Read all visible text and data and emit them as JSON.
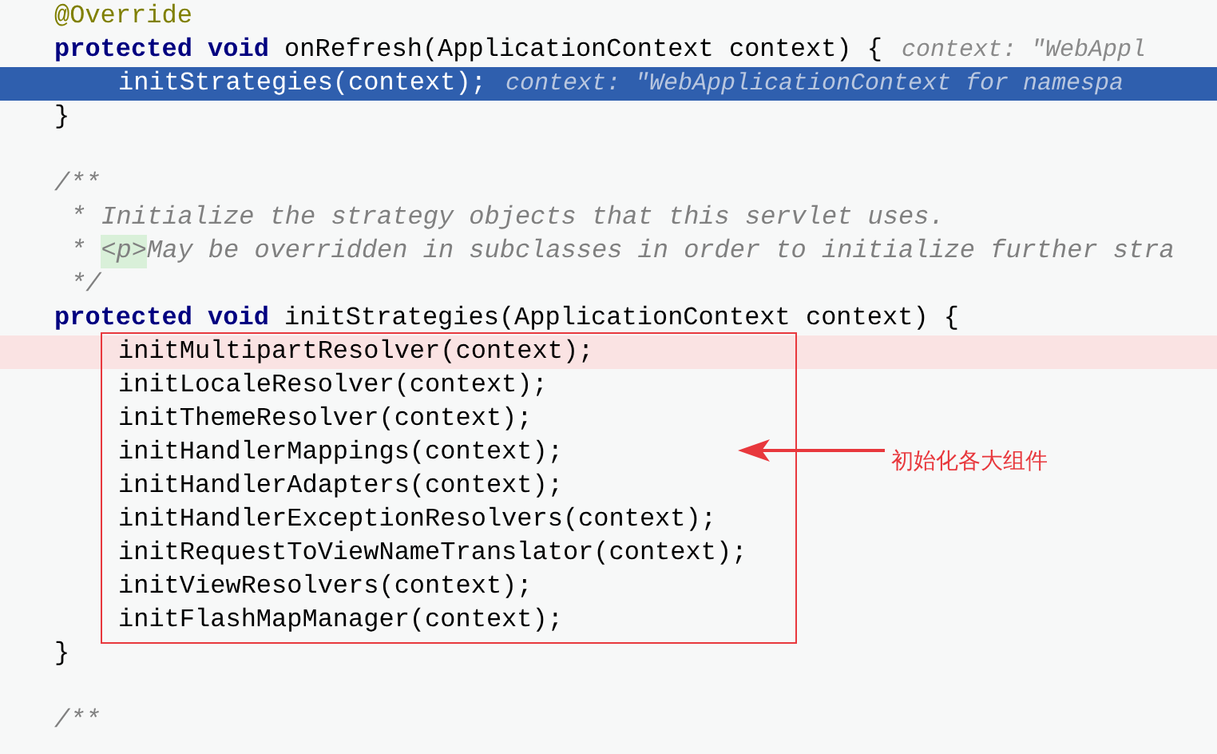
{
  "code_lines": [
    {
      "kind": "code",
      "tokens": [
        {
          "kind": "annotation",
          "text": "@Override"
        }
      ]
    },
    {
      "kind": "code",
      "tokens": [
        {
          "kind": "keyword",
          "text": "protected void"
        },
        {
          "kind": "plain",
          "text": " onRefresh(ApplicationContext context) {"
        },
        {
          "kind": "hint",
          "text": "context: \"WebAppl"
        }
      ],
      "children": [
        {
          "kind": "code",
          "selected": true,
          "tokens": [
            {
              "kind": "plain",
              "text": "initStrategies(context);"
            },
            {
              "kind": "hint",
              "text": "context: \"WebApplicationContext for namespa"
            }
          ]
        }
      ]
    },
    {
      "kind": "code",
      "tokens": [
        {
          "kind": "plain",
          "text": "}"
        }
      ]
    },
    {
      "kind": "blank"
    },
    {
      "kind": "doc_comment",
      "lines": [
        {
          "tokens": [
            {
              "kind": "comment",
              "text": "/**"
            }
          ]
        },
        {
          "tokens": [
            {
              "kind": "comment",
              "text": "* Initialize the strategy objects that this servlet uses."
            }
          ]
        },
        {
          "tokens": [
            {
              "kind": "comment",
              "text": "* "
            },
            {
              "kind": "tag",
              "text": "<p>"
            },
            {
              "kind": "comment",
              "text": "May be overridden in subclasses in order to initialize further stra"
            }
          ]
        },
        {
          "tokens": [
            {
              "kind": "comment",
              "text": "*/"
            }
          ]
        }
      ]
    },
    {
      "kind": "code",
      "tokens": [
        {
          "kind": "keyword",
          "text": "protected void"
        },
        {
          "kind": "plain",
          "text": " initStrategies(ApplicationContext context) {"
        }
      ],
      "callout": {
        "label": "初始化各大组件"
      },
      "children": [
        {
          "kind": "code",
          "marked": true,
          "tokens": [
            {
              "kind": "plain",
              "text": "initMultipartResolver(context);"
            }
          ]
        },
        {
          "kind": "code",
          "marked": false,
          "tokens": [
            {
              "kind": "plain",
              "text": "initLocaleResolver(context);"
            }
          ]
        },
        {
          "kind": "code",
          "marked": false,
          "tokens": [
            {
              "kind": "plain",
              "text": "initThemeResolver(context);"
            }
          ]
        },
        {
          "kind": "code",
          "marked": false,
          "tokens": [
            {
              "kind": "plain",
              "text": "initHandlerMappings(context);"
            }
          ]
        },
        {
          "kind": "code",
          "marked": false,
          "tokens": [
            {
              "kind": "plain",
              "text": "initHandlerAdapters(context);"
            }
          ]
        },
        {
          "kind": "code",
          "marked": false,
          "tokens": [
            {
              "kind": "plain",
              "text": "initHandlerExceptionResolvers(context);"
            }
          ]
        },
        {
          "kind": "code",
          "marked": false,
          "tokens": [
            {
              "kind": "plain",
              "text": "initRequestToViewNameTranslator(context);"
            }
          ]
        },
        {
          "kind": "code",
          "marked": false,
          "tokens": [
            {
              "kind": "plain",
              "text": "initViewResolvers(context);"
            }
          ]
        },
        {
          "kind": "code",
          "marked": false,
          "tokens": [
            {
              "kind": "plain",
              "text": "initFlashMapManager(context);"
            }
          ]
        }
      ]
    },
    {
      "kind": "code",
      "tokens": [
        {
          "kind": "plain",
          "text": "}"
        }
      ]
    },
    {
      "kind": "blank"
    },
    {
      "kind": "doc_comment",
      "lines": [
        {
          "tokens": [
            {
              "kind": "comment",
              "text": "/**"
            }
          ]
        }
      ]
    }
  ]
}
